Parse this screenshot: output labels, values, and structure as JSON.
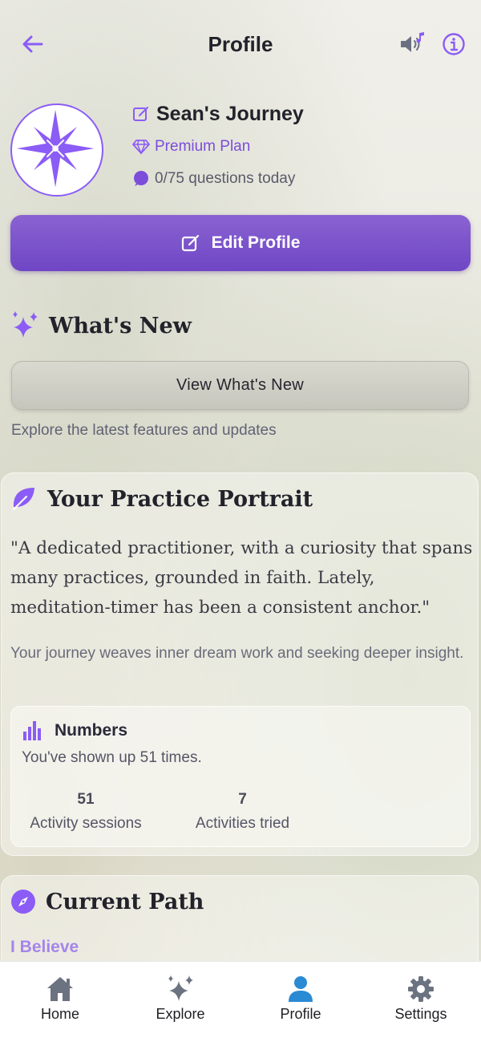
{
  "header": {
    "title": "Profile",
    "back_icon": "arrow-left-icon",
    "sound_icon": "speaker-music-icon",
    "info_icon": "info-icon"
  },
  "profile": {
    "name": "Sean's Journey",
    "plan": "Premium Plan",
    "questions": "0/75 questions today",
    "edit_button": "Edit Profile"
  },
  "whats_new": {
    "title": "What's New",
    "button": "View What's New",
    "subtitle": "Explore the latest features and updates"
  },
  "portrait": {
    "title": "Your Practice Portrait",
    "quote": "\"A dedicated practitioner, with a curiosity that spans many practices, grounded in faith. Lately, meditation-timer has been a consistent anchor.\"",
    "journey": "Your journey weaves inner dream work and seeking deeper insight.",
    "numbers": {
      "title": "Numbers",
      "subtitle": "You've shown up 51 times.",
      "stats": [
        {
          "value": "51",
          "label": "Activity sessions"
        },
        {
          "value": "7",
          "label": "Activities tried"
        }
      ]
    }
  },
  "current_path": {
    "title": "Current Path",
    "path": "I Believe"
  },
  "nav": {
    "items": [
      {
        "label": "Home",
        "icon": "home-icon"
      },
      {
        "label": "Explore",
        "icon": "sparkles-icon"
      },
      {
        "label": "Profile",
        "icon": "person-icon"
      },
      {
        "label": "Settings",
        "icon": "gear-icon"
      }
    ],
    "active": "Profile"
  },
  "colors": {
    "accent": "#8b5cf6",
    "button_purple": "#7550c8",
    "nav_active": "#2a8ad4",
    "nav_inactive": "#6b7280"
  }
}
